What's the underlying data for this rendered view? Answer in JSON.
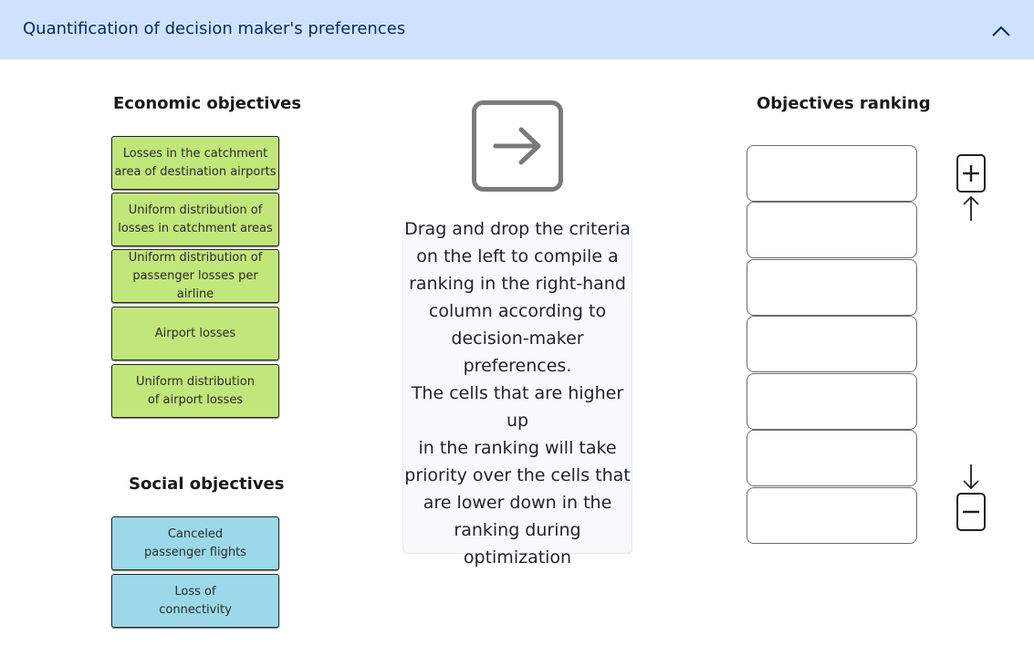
{
  "header": {
    "title": "Quantification of decision maker's preferences",
    "collapse_icon": "chevron-up-icon"
  },
  "economic": {
    "title": "Economic objectives",
    "items": [
      "Losses in the catchment\narea of destination airports",
      "Uniform distribution of\nlosses in catchment areas",
      "Uniform distribution of\npassenger losses per airline",
      "Airport losses",
      "Uniform distribution\nof airport losses"
    ],
    "color": "#c1e67a"
  },
  "social": {
    "title": "Social objectives",
    "items": [
      "Canceled\npassenger flights",
      "Loss of\nconnectivity"
    ],
    "color": "#9bd9ea"
  },
  "center": {
    "arrow_icon": "arrow-right-square-icon",
    "instructions": "Drag and drop the criteria\non the left to compile a\nranking in the right-hand\ncolumn according to\ndecision-maker preferences.\nThe cells that are higher up\nin the ranking will take\npriority over the cells that\nare lower down in the\nranking during optimization"
  },
  "ranking": {
    "title": "Objectives ranking",
    "slot_count": 7,
    "increase_icon": "plus-arrow-up-icon",
    "decrease_icon": "minus-arrow-down-icon"
  }
}
